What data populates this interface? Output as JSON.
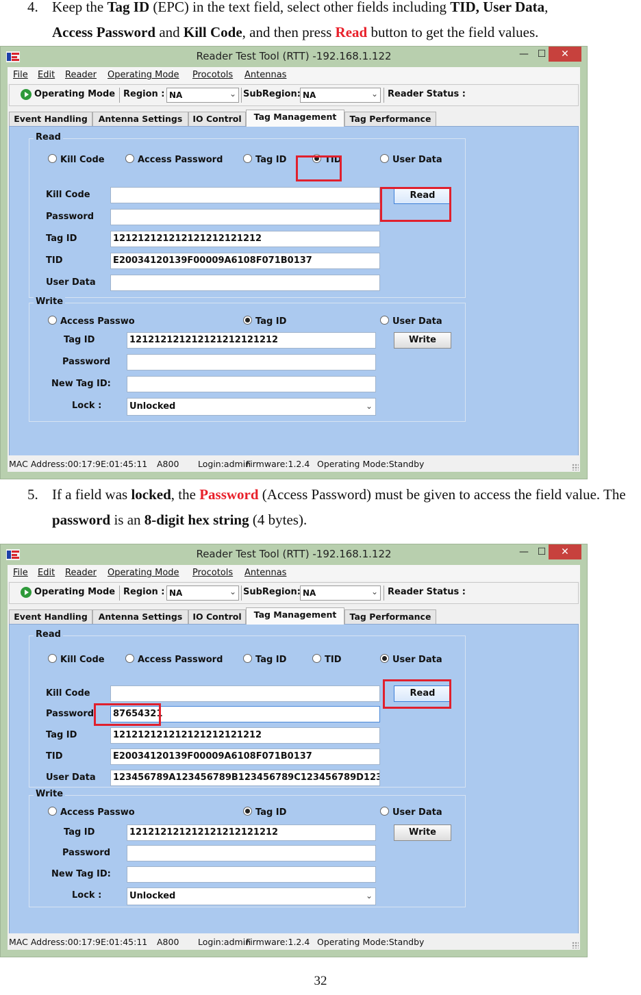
{
  "step4": {
    "num": "4.",
    "t1": "Keep the ",
    "b1": "Tag ID",
    "t2": " (EPC) in the text field, select other fields including ",
    "b2": "TID, User Data",
    "t3": ",",
    "b3": "Access Password",
    "t4": " and ",
    "b4": "Kill Code",
    "t5": ", and then press ",
    "r1": "Read",
    "t6": " button to get the field values."
  },
  "step5": {
    "num": "5.",
    "t1": "If a field was ",
    "b1": "locked",
    "t2": ", the ",
    "r1": "Password",
    "t3": " (Access Password) must be given to access the field value. The ",
    "b2": "password",
    "t4": " is an ",
    "b3": "8-digit hex string",
    "t5": " (4 bytes)."
  },
  "page_number": "32",
  "colors": {
    "window_frame": "#b8cfae",
    "tab_panel": "#abc9ef",
    "highlight": "#e0202d",
    "close_button": "#c7413d"
  },
  "windows": [
    {
      "title": "Reader Test Tool (RTT) -192.168.1.122",
      "controls": {
        "minimize": "—",
        "maximize": "☐",
        "close": "✕"
      },
      "menu": [
        "File",
        "Edit",
        "Reader",
        "Operating Mode",
        "Procotols",
        "Antennas"
      ],
      "toolbar": {
        "operating_mode": "Operating Mode",
        "region_label": "Region :",
        "region_value": "NA",
        "subregion_label": "SubRegion:",
        "subregion_value": "NA",
        "reader_status": "Reader Status :"
      },
      "tabs": [
        "Event Handling",
        "Antenna Settings",
        "IO Control",
        "Tag Management",
        "Tag Performance"
      ],
      "read": {
        "title": "Read",
        "radios": [
          "Kill Code",
          "Access Password",
          "Tag ID",
          "TID",
          "User Data"
        ],
        "selected": "TID",
        "labels": [
          "Kill Code",
          "Password",
          "Tag ID",
          "TID",
          "User Data"
        ],
        "values": [
          "",
          "",
          "121212121212121212121212",
          "E20034120139F00009A6108F071B0137",
          ""
        ],
        "button": "Read"
      },
      "write": {
        "title": "Write",
        "radios": [
          "Access Passwo",
          "Tag ID",
          "User Data"
        ],
        "selected": "Tag ID",
        "labels": [
          "Tag ID",
          "Password",
          "New Tag ID:",
          "Lock :"
        ],
        "values": [
          "121212121212121212121212",
          "",
          ""
        ],
        "lock_value": "Unlocked",
        "button": "Write"
      },
      "status": {
        "mac": "MAC Address:00:17:9E:01:45:11",
        "model": "A800",
        "login": "Login:admin",
        "firmware": "Firmware:1.2.4",
        "mode": "Operating Mode:Standby"
      }
    },
    {
      "title": "Reader Test Tool (RTT) -192.168.1.122",
      "controls": {
        "minimize": "—",
        "maximize": "☐",
        "close": "✕"
      },
      "menu": [
        "File",
        "Edit",
        "Reader",
        "Operating Mode",
        "Procotols",
        "Antennas"
      ],
      "toolbar": {
        "operating_mode": "Operating Mode",
        "region_label": "Region :",
        "region_value": "NA",
        "subregion_label": "SubRegion:",
        "subregion_value": "NA",
        "reader_status": "Reader Status :"
      },
      "tabs": [
        "Event Handling",
        "Antenna Settings",
        "IO Control",
        "Tag Management",
        "Tag Performance"
      ],
      "read": {
        "title": "Read",
        "radios": [
          "Kill Code",
          "Access Password",
          "Tag ID",
          "TID",
          "User Data"
        ],
        "selected": "User Data",
        "labels": [
          "Kill Code",
          "Password",
          "Tag ID",
          "TID",
          "User Data"
        ],
        "values": [
          "",
          "87654321",
          "121212121212121212121212",
          "E20034120139F00009A6108F071B0137",
          "123456789A123456789B123456789C123456789D123"
        ],
        "button": "Read"
      },
      "write": {
        "title": "Write",
        "radios": [
          "Access Passwo",
          "Tag ID",
          "User Data"
        ],
        "selected": "Tag ID",
        "labels": [
          "Tag ID",
          "Password",
          "New Tag ID:",
          "Lock :"
        ],
        "values": [
          "121212121212121212121212",
          "",
          ""
        ],
        "lock_value": "Unlocked",
        "button": "Write"
      },
      "status": {
        "mac": "MAC Address:00:17:9E:01:45:11",
        "model": "A800",
        "login": "Login:admin",
        "firmware": "Firmware:1.2.4",
        "mode": "Operating Mode:Standby"
      }
    }
  ]
}
